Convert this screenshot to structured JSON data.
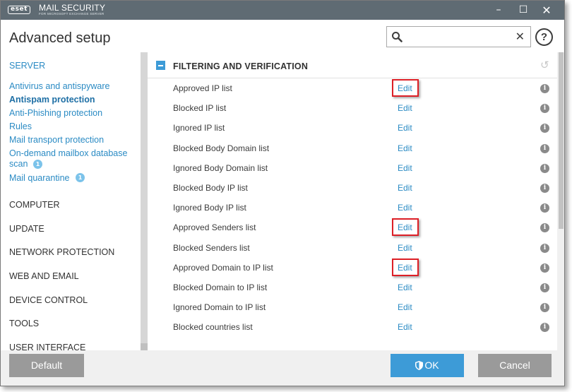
{
  "titlebar": {
    "logo": "eset",
    "product": "MAIL SECURITY",
    "product_sub": "FOR MICROSOFT EXCHANGE SERVER",
    "minimize": "–",
    "maximize": "☐",
    "close": "✕"
  },
  "header": {
    "title": "Advanced setup",
    "search_value": "",
    "search_placeholder": "",
    "clear_glyph": "✕",
    "help_glyph": "?"
  },
  "sidebar": {
    "server": "SERVER",
    "server_items": [
      {
        "label": "Antivirus and antispyware",
        "active": false
      },
      {
        "label": "Antispam protection",
        "active": true
      },
      {
        "label": "Anti-Phishing protection",
        "active": false
      },
      {
        "label": "Rules",
        "active": false
      },
      {
        "label": "Mail transport protection",
        "active": false
      },
      {
        "label": "On-demand mailbox database",
        "active": false
      },
      {
        "label": "scan",
        "badge": "1",
        "active": false
      },
      {
        "label": "Mail quarantine",
        "badge": "1",
        "active": false
      }
    ],
    "sections": [
      "COMPUTER",
      "UPDATE",
      "NETWORK PROTECTION",
      "WEB AND EMAIL",
      "DEVICE CONTROL",
      "TOOLS",
      "USER INTERFACE"
    ]
  },
  "content": {
    "section_title": "FILTERING AND VERIFICATION",
    "revert_glyph": "↺",
    "info_glyph": "i",
    "rows": [
      {
        "label": "Approved IP list",
        "action": "Edit",
        "highlighted": true
      },
      {
        "label": "Blocked IP list",
        "action": "Edit",
        "highlighted": false
      },
      {
        "label": "Ignored IP list",
        "action": "Edit",
        "highlighted": false
      },
      {
        "label": "Blocked Body Domain list",
        "action": "Edit",
        "highlighted": false
      },
      {
        "label": "Ignored Body Domain list",
        "action": "Edit",
        "highlighted": false
      },
      {
        "label": "Blocked Body IP list",
        "action": "Edit",
        "highlighted": false
      },
      {
        "label": "Ignored Body IP list",
        "action": "Edit",
        "highlighted": false
      },
      {
        "label": "Approved Senders list",
        "action": "Edit",
        "highlighted": true
      },
      {
        "label": "Blocked Senders list",
        "action": "Edit",
        "highlighted": false
      },
      {
        "label": "Approved Domain to IP list",
        "action": "Edit",
        "highlighted": true
      },
      {
        "label": "Blocked Domain to IP list",
        "action": "Edit",
        "highlighted": false
      },
      {
        "label": "Ignored Domain to IP list",
        "action": "Edit",
        "highlighted": false
      },
      {
        "label": "Blocked countries list",
        "action": "Edit",
        "highlighted": false
      }
    ]
  },
  "footer": {
    "default_label": "Default",
    "ok_label": "OK",
    "cancel_label": "Cancel"
  },
  "colors": {
    "titlebar": "#5f6b73",
    "accent": "#3d9bd7",
    "link": "#2b8bc4",
    "highlight": "#dd1f26",
    "button_gray": "#9a9a9a"
  }
}
